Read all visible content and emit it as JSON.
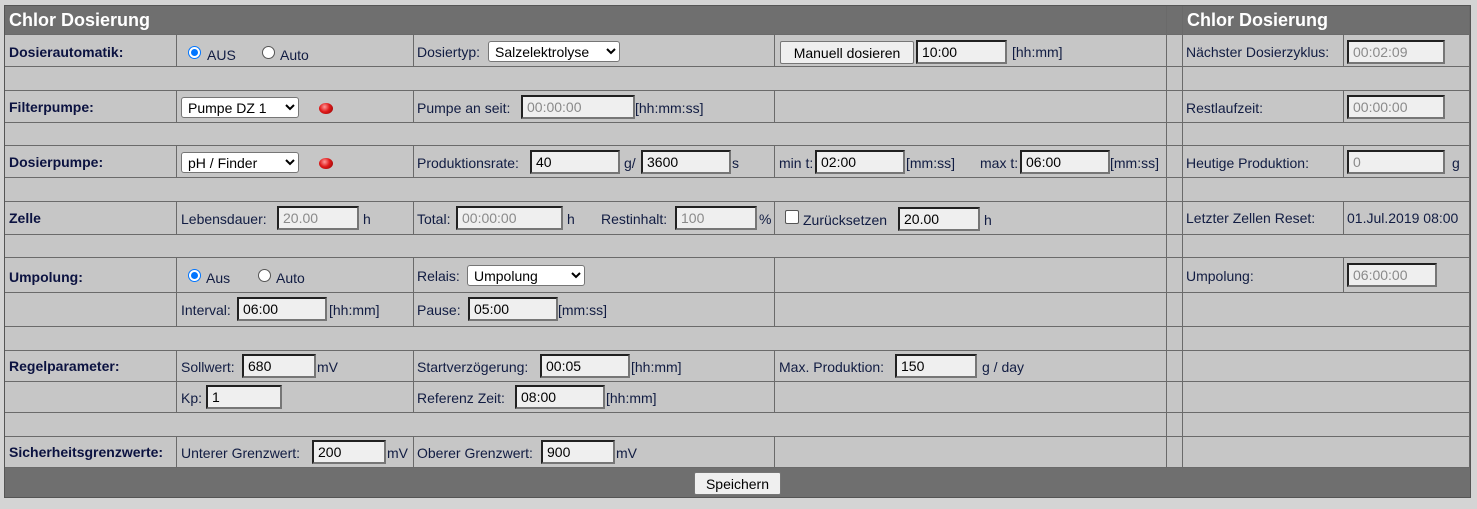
{
  "title_main": "Chlor Dosierung",
  "title_side": "Chlor Dosierung",
  "dosierautomatik": {
    "label": "Dosierautomatik:",
    "radio_aus": "AUS",
    "radio_auto": "Auto",
    "selected": "AUS",
    "typ_label": "Dosiertyp:",
    "typ_value": "Salzelektrolyse",
    "manual_button": "Manuell dosieren",
    "manual_value": "10:00",
    "manual_unit": "[hh:mm]",
    "next_label": "Nächster Dosierzyklus:",
    "next_value": "00:02:09"
  },
  "filterpumpe": {
    "label": "Filterpumpe:",
    "select_value": "Pumpe DZ 1",
    "status_color": "#e01a1a",
    "on_since_label": "Pumpe an seit:",
    "on_since_value": "00:00:00",
    "on_since_unit": "[hh:mm:ss]",
    "rest_label": "Restlaufzeit:",
    "rest_value": "00:00:00"
  },
  "dosierpumpe": {
    "label": "Dosierpumpe:",
    "select_value": "pH / Finder",
    "status_color": "#e01a1a",
    "rate_label": "Produktionsrate:",
    "rate_value": "40",
    "rate_unit_g": "g/",
    "rate_time": "3600",
    "rate_unit_s": "s",
    "min_label": "min t:",
    "min_value": "02:00",
    "min_unit": "[mm:ss]",
    "max_label": "max t:",
    "max_value": "06:00",
    "max_unit": "[mm:ss]",
    "today_label": "Heutige Produktion:",
    "today_value": "0",
    "today_unit": "g"
  },
  "zelle": {
    "label": "Zelle",
    "life_label": "Lebensdauer:",
    "life_value": "20.00",
    "life_unit": "h",
    "total_label": "Total:",
    "total_value": "00:00:00",
    "total_unit": "h",
    "rest_label": "Restinhalt:",
    "rest_value": "100",
    "rest_unit": "%",
    "reset_label": "Zurücksetzen",
    "reset_value": "20.00",
    "reset_unit": "h",
    "last_reset_label": "Letzter Zellen Reset:",
    "last_reset_value": "01.Jul.2019 08:00"
  },
  "umpolung": {
    "label": "Umpolung:",
    "radio_aus": "Aus",
    "radio_auto": "Auto",
    "selected": "Aus",
    "relais_label": "Relais:",
    "relais_value": "Umpolung",
    "side_label": "Umpolung:",
    "side_value": "06:00:00",
    "interval_label": "Interval:",
    "interval_value": "06:00",
    "interval_unit": "[hh:mm]",
    "pause_label": "Pause:",
    "pause_value": "05:00",
    "pause_unit": "[mm:ss]"
  },
  "regelparameter": {
    "label": "Regelparameter:",
    "soll_label": "Sollwert:",
    "soll_value": "680",
    "soll_unit": "mV",
    "start_label": "Startverzögerung:",
    "start_value": "00:05",
    "start_unit": "[hh:mm]",
    "maxprod_label": "Max. Produktion:",
    "maxprod_value": "150",
    "maxprod_unit": "g / day",
    "kp_label": "Kp:",
    "kp_value": "1",
    "ref_label": "Referenz Zeit:",
    "ref_value": "08:00",
    "ref_unit": "[hh:mm]"
  },
  "sicherheit": {
    "label": "Sicherheitsgrenzwerte:",
    "lower_label": "Unterer Grenzwert:",
    "lower_value": "200",
    "lower_unit": "mV",
    "upper_label": "Oberer Grenzwert:",
    "upper_value": "900",
    "upper_unit": "mV"
  },
  "save_button": "Speichern"
}
